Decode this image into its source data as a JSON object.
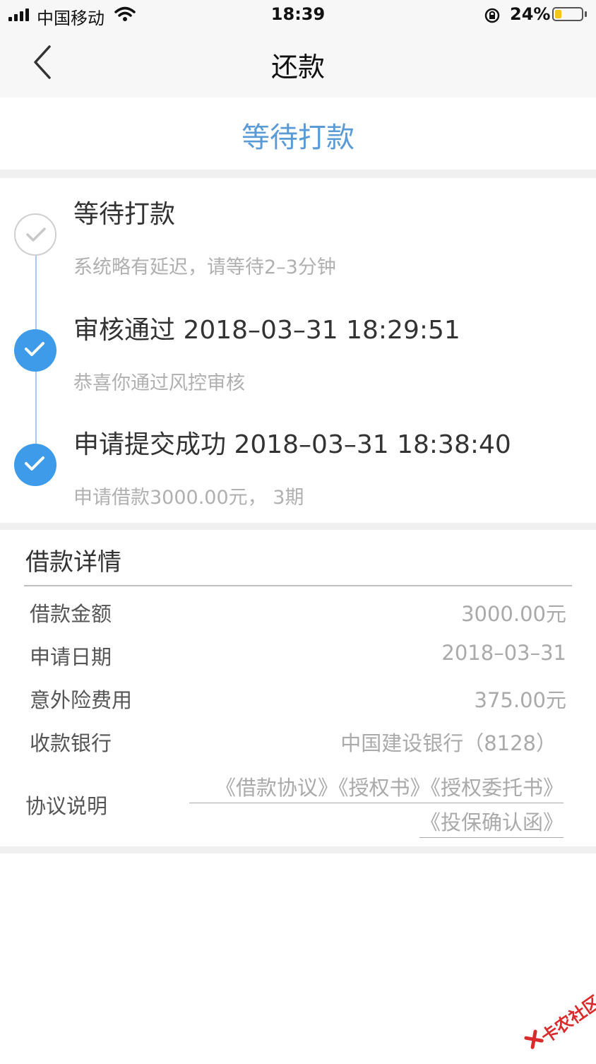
{
  "status_bar": {
    "carrier": "中国移动",
    "time": "18:39",
    "battery": "24%",
    "battery_level": 0.24,
    "icons": [
      "signal-icon",
      "wifi-icon",
      "orientation-lock-icon",
      "battery-icon"
    ]
  },
  "nav": {
    "back_icon": "chevron-left-icon",
    "title": "还款"
  },
  "status_header": {
    "title": "等待打款",
    "color": "#5b9bd5"
  },
  "timeline": [
    {
      "title": "等待打款",
      "desc": "系统略有延迟，请等待2–3分钟",
      "state": "pending",
      "icon": "check-circle-outline-icon"
    },
    {
      "title": "审核通过 2018–03–31 18:29:51",
      "desc": "恭喜你通过风控审核",
      "state": "done",
      "icon": "check-circle-filled-icon"
    },
    {
      "title": "申请提交成功 2018–03–31 18:38:40",
      "desc": "申请借款3000.00元，  3期",
      "state": "done",
      "icon": "check-circle-filled-icon"
    }
  ],
  "detail": {
    "heading": "借款详情",
    "rows": [
      {
        "label": "借款金额",
        "value": "3000.00元"
      },
      {
        "label": "申请日期",
        "value": "2018–03–31"
      },
      {
        "label": "意外险费用",
        "value": "375.00元"
      },
      {
        "label": "收款银行",
        "value": "中国建设银行（8128）"
      }
    ],
    "agreement_label": "协议说明",
    "agreements": [
      "《借款协议》",
      "《授权书》",
      "《授权委托书》",
      "《投保确认函》"
    ]
  },
  "watermark": {
    "text": "卡农社区",
    "color": "#d92b2b"
  },
  "colors": {
    "accent_blue": "#3d9be9",
    "timeline_line": "#a9c8ea",
    "divider_bg": "#f0f0f0"
  }
}
